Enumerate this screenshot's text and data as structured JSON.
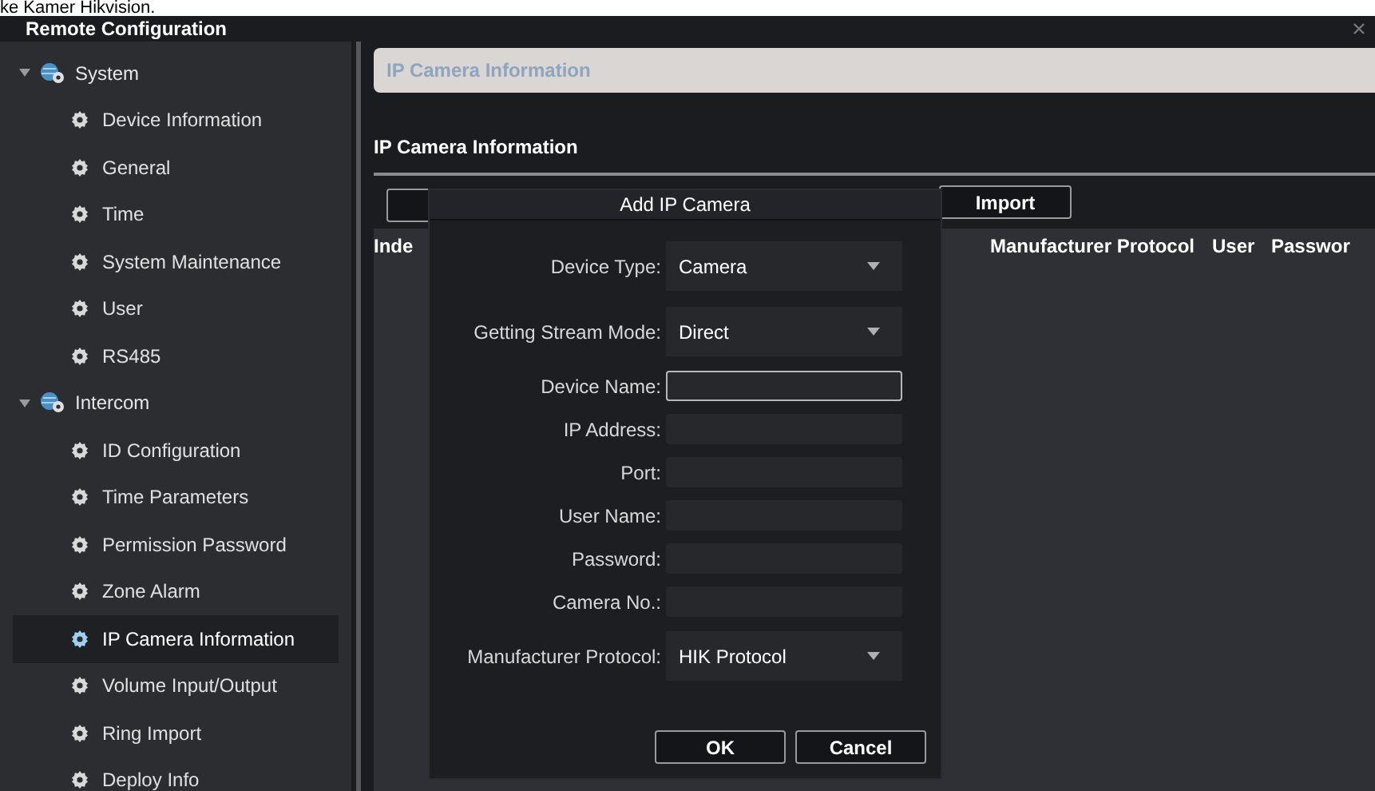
{
  "caption": "ke Kamer Hikvision.",
  "window": {
    "title": "Remote Configuration"
  },
  "sidebar": {
    "items": [
      {
        "label": "System",
        "expanded": true,
        "children": [
          {
            "label": "Device Information",
            "selected": false
          },
          {
            "label": "General",
            "selected": false
          },
          {
            "label": "Time",
            "selected": false
          },
          {
            "label": "System Maintenance",
            "selected": false
          },
          {
            "label": "User",
            "selected": false
          },
          {
            "label": "RS485",
            "selected": false
          }
        ]
      },
      {
        "label": "Intercom",
        "expanded": true,
        "children": [
          {
            "label": "ID Configuration",
            "selected": false
          },
          {
            "label": "Time Parameters",
            "selected": false
          },
          {
            "label": "Permission Password",
            "selected": false
          },
          {
            "label": "Zone Alarm",
            "selected": false
          },
          {
            "label": "IP Camera Information",
            "selected": true
          },
          {
            "label": "Volume Input/Output",
            "selected": false
          },
          {
            "label": "Ring Import",
            "selected": false
          },
          {
            "label": "Deploy Info",
            "selected": false
          }
        ]
      }
    ]
  },
  "page_header": "IP Camera Information",
  "section_title": "IP Camera Information",
  "toolbar": {
    "buttons": [
      "Import"
    ]
  },
  "table": {
    "columns": [
      "Inde",
      "Manufacturer Protocol",
      "User",
      "Passwor"
    ]
  },
  "dialog": {
    "title": "Add IP Camera",
    "fields": [
      {
        "kind": "select",
        "label": "Device Type:",
        "value": "Camera"
      },
      {
        "kind": "select",
        "label": "Getting Stream Mode:",
        "value": "Direct"
      },
      {
        "kind": "input",
        "label": "Device Name:",
        "focused": true
      },
      {
        "kind": "input",
        "label": "IP Address:",
        "focused": false
      },
      {
        "kind": "input",
        "label": "Port:",
        "focused": false
      },
      {
        "kind": "input",
        "label": "User Name:",
        "focused": false
      },
      {
        "kind": "input",
        "label": "Password:",
        "focused": false
      },
      {
        "kind": "input",
        "label": "Camera No.:",
        "focused": false
      },
      {
        "kind": "select",
        "label": "Manufacturer Protocol:",
        "value": "HIK Protocol"
      }
    ],
    "buttons": [
      "OK",
      "Cancel"
    ]
  }
}
